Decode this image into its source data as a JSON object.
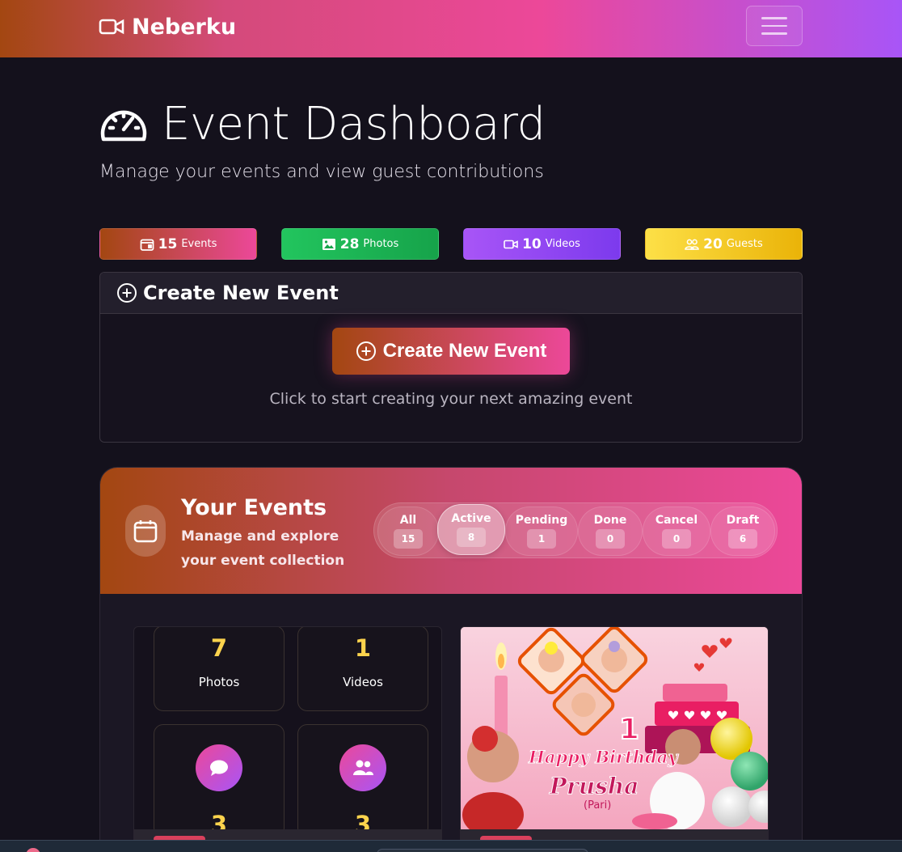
{
  "navbar": {
    "brand": "Neberku",
    "brand_icon": "video-camera-icon",
    "menu_icon": "hamburger-icon"
  },
  "header": {
    "title": "Event Dashboard",
    "title_icon": "speedometer-icon",
    "subtitle": "Manage your events and view guest contributions"
  },
  "stats": {
    "events": {
      "count": "15",
      "label": "Events",
      "icon": "calendar-icon"
    },
    "photos": {
      "count": "28",
      "label": "Photos",
      "icon": "image-icon"
    },
    "videos": {
      "count": "10",
      "label": "Videos",
      "icon": "video-camera-icon"
    },
    "guests": {
      "count": "20",
      "label": "Guests",
      "icon": "people-icon"
    }
  },
  "create": {
    "header": "Create New Event",
    "button_label": "Create New Event",
    "hint": "Click to start creating your next amazing event"
  },
  "your_events": {
    "title": "Your Events",
    "description": "Manage and explore your event collection",
    "filters": [
      {
        "label": "All",
        "count": "15"
      },
      {
        "label": "Active",
        "count": "8"
      },
      {
        "label": "Pending",
        "count": "1"
      },
      {
        "label": "Done",
        "count": "0"
      },
      {
        "label": "Cancel",
        "count": "0"
      },
      {
        "label": "Draft",
        "count": "6"
      }
    ],
    "active_filter": "Active"
  },
  "event_card_1": {
    "photos_count": "7",
    "photos_label": "Photos",
    "videos_count": "1",
    "videos_label": "Videos",
    "comments_count": "3",
    "guests_count": "3"
  },
  "event_card_2": {
    "banner_text": "Happy Birthday",
    "banner_name": "Prusha",
    "banner_nickname": "(Pari)",
    "banner_age": "1"
  },
  "colors": {
    "accent_start": "#a34711",
    "accent_pink": "#ec4899",
    "accent_purple": "#a855f7",
    "count_yellow": "#fcd34d"
  }
}
